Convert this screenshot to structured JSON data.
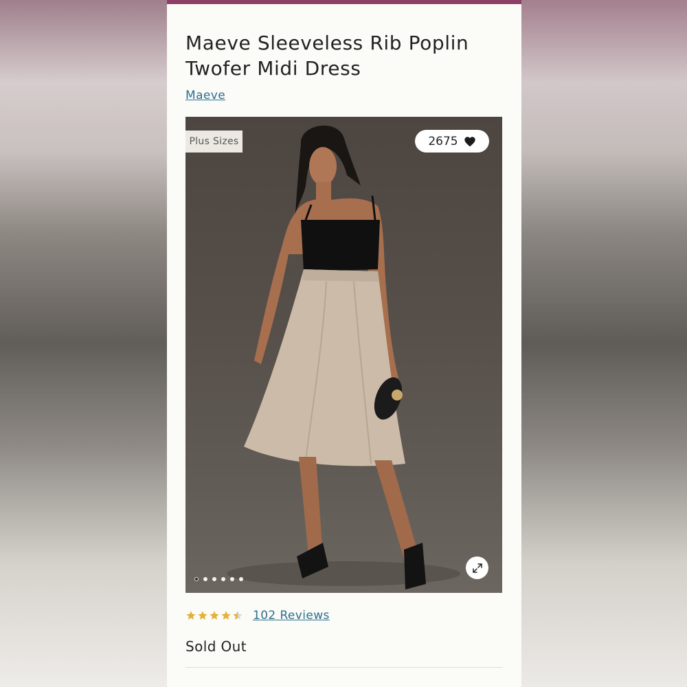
{
  "product": {
    "title": "Maeve Sleeveless Rib Poplin Twofer Midi Dress",
    "brand": "Maeve"
  },
  "image": {
    "badge": "Plus Sizes",
    "favorites_count": "2675",
    "favorite_icon": "heart-icon",
    "expand_icon": "expand-icon",
    "carousel_total": 6,
    "carousel_active_index": 0
  },
  "rating": {
    "stars": 4.5,
    "reviews_label": "102 Reviews"
  },
  "availability": {
    "status": "Sold Out"
  },
  "colors": {
    "accent_strip": "#8e3f66",
    "link": "#2b6f8c",
    "star": "#e2b23a"
  }
}
